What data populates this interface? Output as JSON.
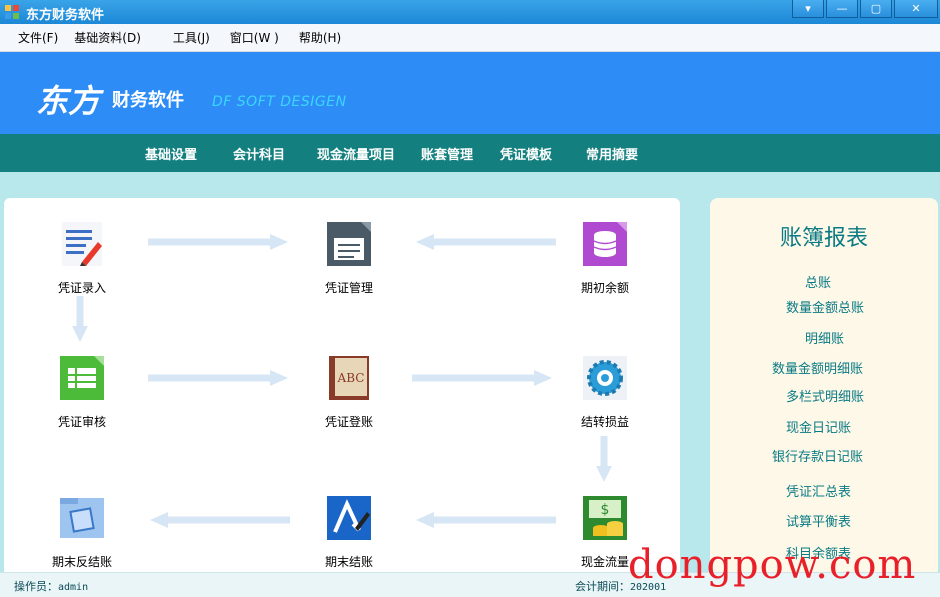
{
  "window": {
    "title": "东方财务软件",
    "controls": [
      "▾",
      "—",
      "▢",
      "✕"
    ]
  },
  "menubar": {
    "items": [
      "文件(F)",
      "基础资料(D)",
      "工具(J)",
      "窗口(W )",
      "帮助(H)"
    ]
  },
  "banner": {
    "brand": "东方",
    "subtitle": "财务软件",
    "english": "DF SOFT DESIGEN"
  },
  "nav": {
    "items": [
      "基础设置",
      "会计科目",
      "现金流量项目",
      "账套管理",
      "凭证模板",
      "常用摘要"
    ]
  },
  "workflow": {
    "voucher_entry": "凭证录入",
    "voucher_manage": "凭证管理",
    "opening_balance": "期初余额",
    "voucher_audit": "凭证审核",
    "voucher_post": "凭证登账",
    "carry_pl": "结转损益",
    "reverse_close": "期末反结账",
    "period_close": "期末结账",
    "cash_flow": "现金流量"
  },
  "reports": {
    "title": "账簿报表",
    "links": [
      "总账",
      "数量金额总账",
      "明细账",
      "数量金额明细账",
      "多栏式明细账",
      "现金日记账",
      "银行存款日记账",
      "凭证汇总表",
      "试算平衡表",
      "科目余额表"
    ]
  },
  "status": {
    "operator_label": "操作员：",
    "operator_value": "admin",
    "period_label": "会计期间：",
    "period_value": "202001"
  },
  "watermark": "dongpow.com",
  "colors": {
    "banner": "#2d8cf6",
    "navbar": "#13807f",
    "link": "#0a7a84",
    "watermark": "#e8202a"
  }
}
